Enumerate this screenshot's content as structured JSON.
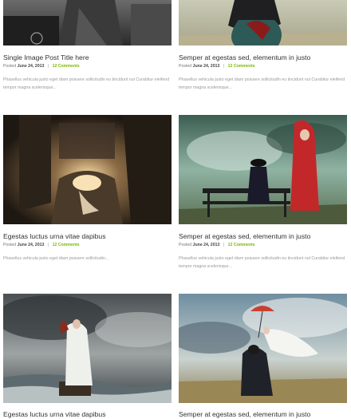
{
  "posts": [
    {
      "title": "Single Image Post Title here",
      "posted_label": "Posted",
      "date": "June 24, 2013",
      "separator": "|",
      "comments": "12 Comments",
      "excerpt": "Phasellus vehicula justo eget diam posuere sollicitudin eu tincidunt nul Curabitur eleifend  tempor magna scelerisque..."
    },
    {
      "title": "Semper at egestas sed, elementum in justo",
      "posted_label": "Posted",
      "date": "June 24, 2013",
      "separator": "|",
      "comments": "12 Comments",
      "excerpt": "Phasellus vehicula justo eget diam posuere sollicitudin eu tincidunt nul Curabitur eleifend  tempor magna scelerisque..."
    },
    {
      "title": "Egestas luctus urna vitae dapibus",
      "posted_label": "Posted",
      "date": "June 24, 2013",
      "separator": "|",
      "comments": "12 Comments",
      "excerpt": "Phasellus vehicula justo eget diam posuere sollicitudin..."
    },
    {
      "title": "Semper at egestas sed, elementum in justo",
      "posted_label": "Posted",
      "date": "June 24, 2013",
      "separator": "|",
      "comments": "12 Comments",
      "excerpt": "Phasellus vehicula justo eget diam posuere sollicitudin eu tincidunt nul Curabitur eleifend  tempor magna scelerisque..."
    },
    {
      "title": "Egestas luctus urna vitae dapibus"
    },
    {
      "title": "Semper at egestas sed, elementum in justo"
    }
  ],
  "colors": {
    "title": "#333333",
    "meta": "#777777",
    "comments_link": "#7ab800",
    "excerpt": "#999999"
  }
}
